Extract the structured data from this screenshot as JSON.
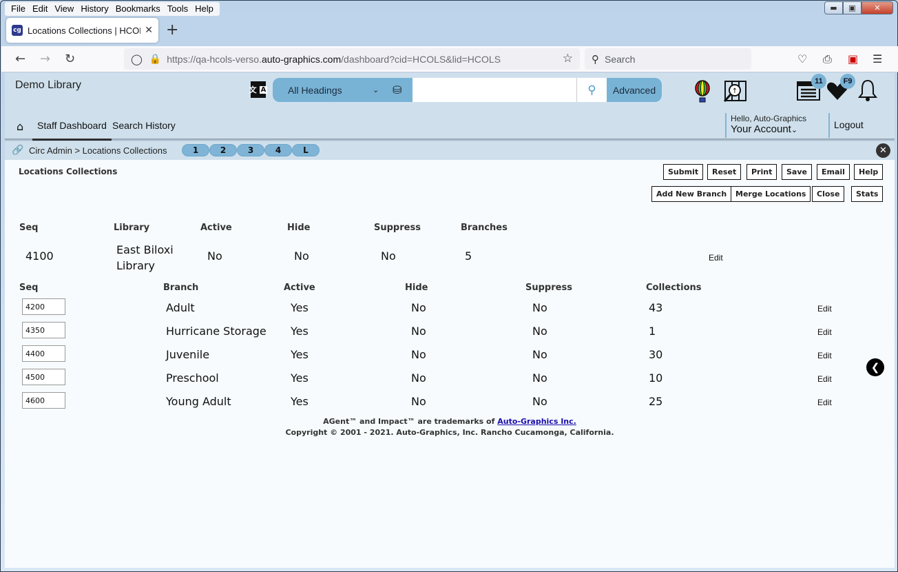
{
  "browser": {
    "menu": [
      "File",
      "Edit",
      "View",
      "History",
      "Bookmarks",
      "Tools",
      "Help"
    ],
    "tab_title": "Locations Collections | HCOLS | ",
    "url_prefix": "https://qa-hcols-verso.",
    "url_domain": "auto-graphics.com",
    "url_path": "/dashboard?cid=HCOLS&lid=HCOLS",
    "search_placeholder": "Search"
  },
  "header": {
    "library_name": "Demo Library",
    "search_scope": "All Headings",
    "search_value": "",
    "advanced_label": "Advanced",
    "list_badge": "11",
    "favorites_badge": "F9",
    "nav": [
      "Staff Dashboard",
      "Search History"
    ],
    "greeting": "Hello, Auto-Graphics",
    "account_label": "Your Account",
    "logout_label": "Logout"
  },
  "breadcrumb": {
    "path": "Circ Admin > Locations Collections",
    "pills": [
      "1",
      "2",
      "3",
      "4",
      "L"
    ]
  },
  "page": {
    "title": "Locations Collections",
    "buttons_row1": [
      "Submit",
      "Reset",
      "Print",
      "Save",
      "Email",
      "Help"
    ],
    "buttons_row2": [
      "Add New Branch",
      "Merge Locations",
      "Close",
      "Stats"
    ]
  },
  "library_table": {
    "headers": [
      "Seq",
      "Library",
      "Active",
      "Hide",
      "Suppress",
      "Branches"
    ],
    "row": {
      "seq": "4100",
      "library": "East Biloxi Library",
      "active": "No",
      "hide": "No",
      "suppress": "No",
      "branches": "5",
      "edit": "Edit"
    }
  },
  "branch_table": {
    "headers": [
      "Seq",
      "Branch",
      "Active",
      "Hide",
      "Suppress",
      "Collections"
    ],
    "rows": [
      {
        "seq": "4200",
        "branch": "Adult",
        "active": "Yes",
        "hide": "No",
        "suppress": "No",
        "collections": "43",
        "edit": "Edit"
      },
      {
        "seq": "4350",
        "branch": "Hurricane Storage",
        "active": "Yes",
        "hide": "No",
        "suppress": "No",
        "collections": "1",
        "edit": "Edit"
      },
      {
        "seq": "4400",
        "branch": "Juvenile",
        "active": "Yes",
        "hide": "No",
        "suppress": "No",
        "collections": "30",
        "edit": "Edit"
      },
      {
        "seq": "4500",
        "branch": "Preschool",
        "active": "Yes",
        "hide": "No",
        "suppress": "No",
        "collections": "10",
        "edit": "Edit"
      },
      {
        "seq": "4600",
        "branch": "Young Adult",
        "active": "Yes",
        "hide": "No",
        "suppress": "No",
        "collections": "25",
        "edit": "Edit"
      }
    ]
  },
  "footer": {
    "trademark_text": "AGent™ and Impact™ are trademarks of ",
    "trademark_link": "Auto-Graphics Inc.",
    "copyright": "Copyright © 2001 - 2021. Auto-Graphics, Inc. Rancho Cucamonga, California."
  },
  "colors": {
    "header_bg": "#cfe0ec",
    "accent_blue": "#78b3d6",
    "content_bg": "#f7fbfd"
  }
}
